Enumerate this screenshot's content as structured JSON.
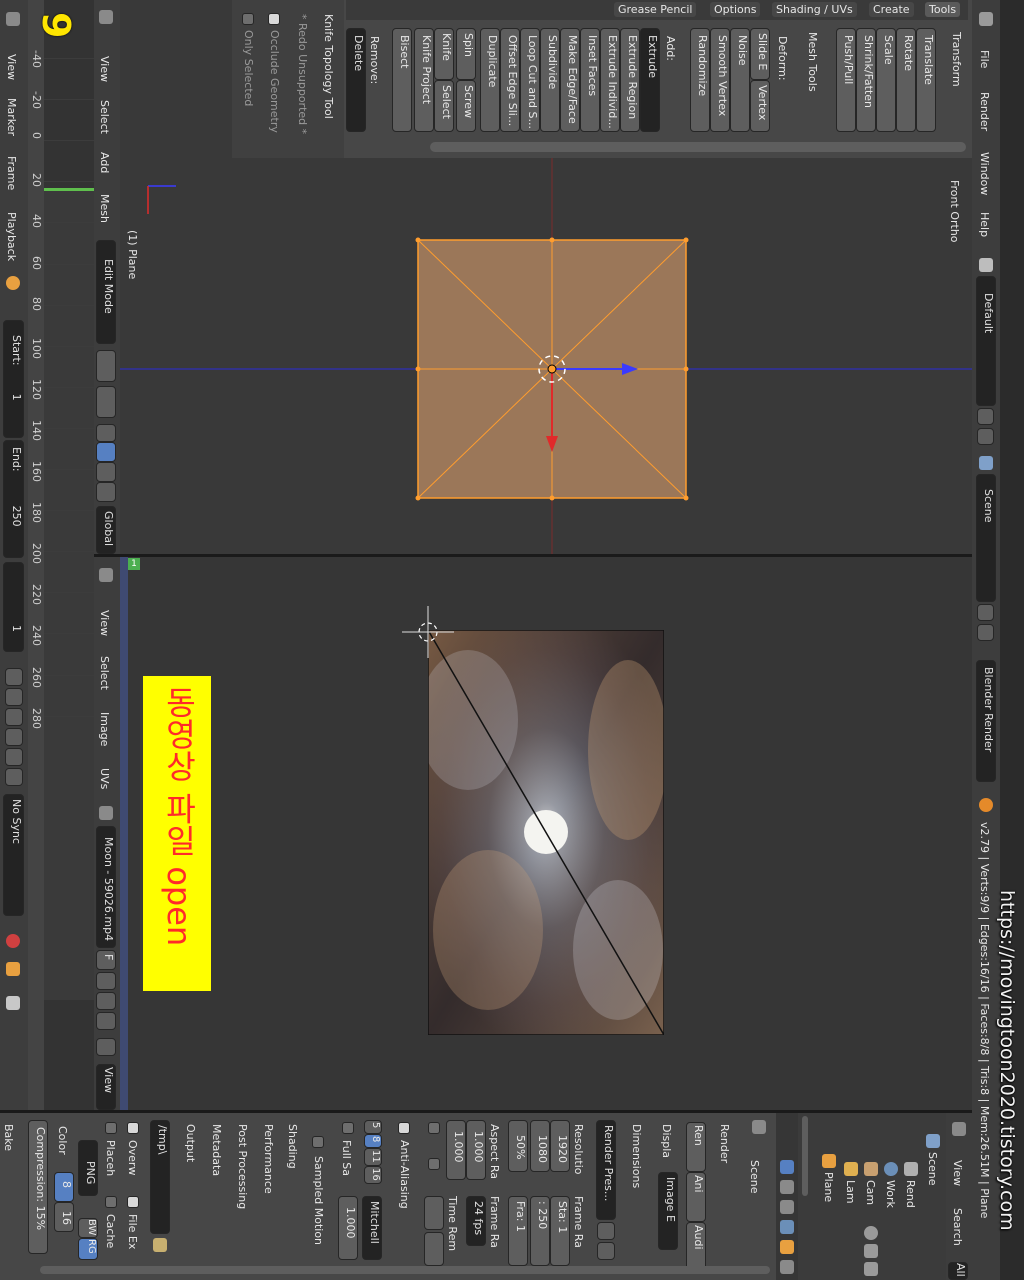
{
  "top_header": {
    "menus": [
      "File",
      "Render",
      "Window",
      "Help"
    ],
    "layout": "Default",
    "scene": "Scene",
    "engine": "Blender Render",
    "stats": "v2.79 | Verts:9/9 | Edges:16/16 | Faces:8/8 | Tris:8 | Mem:26.51M | Plane"
  },
  "watermark": "https://movingtoon2020.tistory.com",
  "tool_tabs": [
    "Tools",
    "Create",
    "Shading / UVs",
    "Options",
    "Grease Pencil"
  ],
  "tools_panel": {
    "transform_header": "Transform",
    "transform_buttons": [
      "Translate",
      "Rotate",
      "Scale",
      "Shrink/Fatten",
      "Push/Pull"
    ],
    "mesh_tools_header": "Mesh Tools",
    "deform_label": "Deform:",
    "deform_buttons": [
      "Slide E",
      "Vertex",
      "Noise",
      "Smooth Vertex",
      "Randomize"
    ],
    "add_label": "Add:",
    "add_buttons": [
      "Extrude",
      "Extrude Region",
      "Extrude Individ...",
      "Inset Faces",
      "Make Edge/Face",
      "Subdivide",
      "Loop Cut and S...",
      "Offset Edge Sli...",
      "Duplicate",
      "Spin",
      "Screw",
      "Knife",
      "Select",
      "Knife Project",
      "Bisect"
    ],
    "remove_label": "Remove:",
    "remove_button": "Delete",
    "knife_header": "Knife Topology Tool",
    "redo": "* Redo Unsupported *",
    "occlude": "Occlude Geometry",
    "only_selected": "Only Selected"
  },
  "viewport": {
    "view_name": "Front Ortho",
    "object_name": "(1) Plane",
    "header_menus": [
      "View",
      "Select",
      "Add",
      "Mesh"
    ],
    "mode": "Edit Mode",
    "orientation": "Global"
  },
  "image_editor": {
    "header_menus": [
      "View",
      "Select",
      "Image",
      "UVs"
    ],
    "image_name": "Moon - 59026.mp4",
    "frame_badge": "1",
    "view_label": "View"
  },
  "annotation": "동영상 파일 open",
  "annotation_number": "9",
  "timeline": {
    "ticks": [
      "-40",
      "-20",
      "0",
      "20",
      "40",
      "60",
      "80",
      "100",
      "120",
      "140",
      "160",
      "180",
      "200",
      "220",
      "240",
      "260",
      "280"
    ],
    "menus": [
      "View",
      "Marker",
      "Frame",
      "Playback"
    ],
    "start_label": "Start:",
    "start_value": "1",
    "end_label": "End:",
    "end_value": "250",
    "current_frame": "1",
    "sync": "No Sync"
  },
  "outliner": {
    "header_menus": [
      "View",
      "Search",
      "All"
    ],
    "items": [
      "Scene",
      "Rend",
      "Work",
      "Cam",
      "Lam",
      "Plane"
    ]
  },
  "properties": {
    "scene_tab": "Scene",
    "render_header": "Render",
    "render_buttons": [
      "Ren",
      "Ani",
      "Audi"
    ],
    "display_label": "Displa",
    "display_value": "Image E",
    "dimensions_header": "Dimensions",
    "render_presets": "Render Pres...",
    "resolution_label": "Resolutio",
    "res_x": "1920",
    "res_y": "1080",
    "res_pct": "50%",
    "frame_range_label": "Frame Ra",
    "frame_start": "Sta: 1",
    "frame_end": ": 250",
    "frame_step": "Fra: 1",
    "aspect_label": "Aspect Ra",
    "aspect_x": "1.000",
    "aspect_y": "1.000",
    "frame_rate_label": "Frame Ra",
    "fps": "24 fps",
    "time_remap_label": "Time Rem",
    "aa_header": "Anti-Aliasing",
    "aa_samples": [
      "5",
      "8",
      "11",
      "16"
    ],
    "aa_filter": "Mitchell",
    "full_sample": "Full Sa",
    "aa_size": "1.000",
    "sampled_motion": "Sampled Motion",
    "shading": "Shading",
    "performance": "Performance",
    "post_processing": "Post Processing",
    "metadata": "Metadata",
    "output_header": "Output",
    "output_path": "/tmp\\",
    "overwrite": "Overw",
    "file_ext": "File Ex",
    "placeholders": "Placeh",
    "cache": "Cache",
    "format": "PNG",
    "color_modes": [
      "BW",
      "RG",
      "RG"
    ],
    "color_label": "Color",
    "color_depth": [
      "8",
      "16"
    ],
    "compression": "Compression: 15%",
    "bake": "Bake"
  },
  "colors": {
    "accent_blue": "#5680c2",
    "mesh_face": "#c08b5f",
    "mesh_edge": "#ff9d2e",
    "annotation_bg": "#ffff00",
    "annotation_text": "#ff2a2a"
  }
}
